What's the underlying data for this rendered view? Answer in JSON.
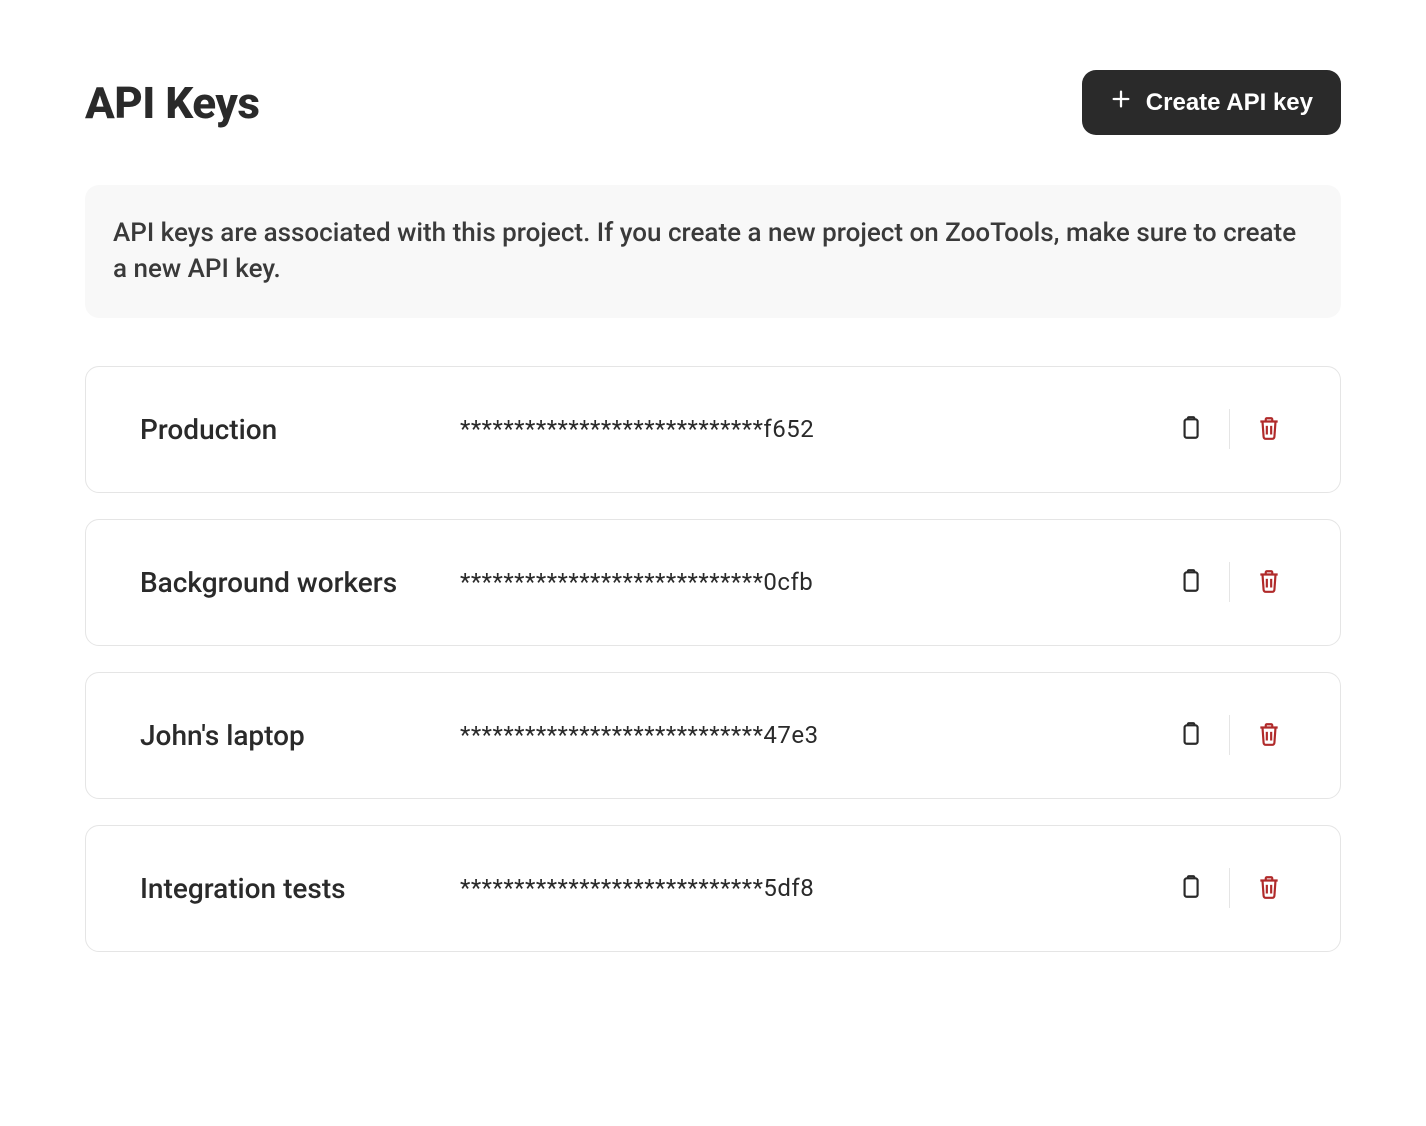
{
  "header": {
    "title": "API Keys",
    "create_button_label": "Create API key"
  },
  "info": {
    "text": "API keys are associated with this project. If you create a new project on ZooTools, make sure to create a new API key."
  },
  "keys": [
    {
      "name": "Production",
      "masked_value": "****************************f652"
    },
    {
      "name": "Background workers",
      "masked_value": "****************************0cfb"
    },
    {
      "name": "John's laptop",
      "masked_value": "****************************47e3"
    },
    {
      "name": "Integration tests",
      "masked_value": "****************************5df8"
    }
  ]
}
